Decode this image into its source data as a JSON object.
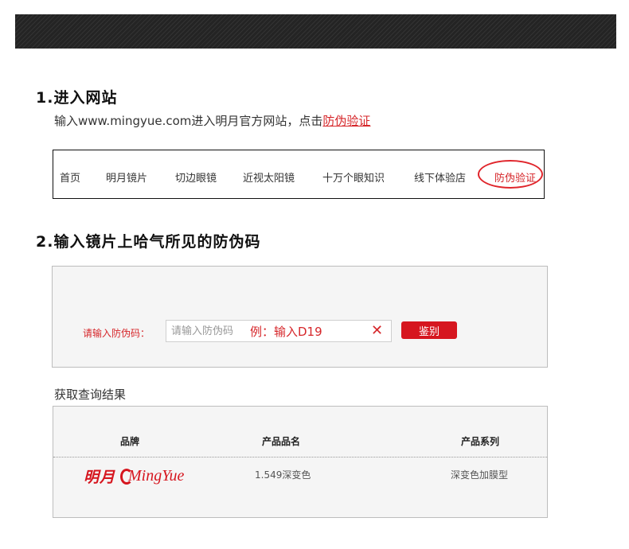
{
  "step1": {
    "title": "1.进入网站",
    "desc_prefix": "输入www.mingyue.com进入明月官方网站，点击",
    "desc_link": "防伪验证"
  },
  "nav": {
    "items": [
      "首页",
      "明月镜片",
      "切边眼镜",
      "近视太阳镜",
      "十万个眼知识",
      "线下体验店",
      "防伪验证"
    ],
    "active_index": 6
  },
  "step2": {
    "title": "2.输入镜片上哈气所见的防伪码"
  },
  "form": {
    "label": "请输入防伪码：",
    "placeholder": "请输入防伪码",
    "example": "例：输入D19",
    "clear": "✕",
    "button": "鉴别"
  },
  "result": {
    "title": "获取查询结果",
    "columns": [
      "品牌",
      "产品品名",
      "产品系列"
    ],
    "row": {
      "brand_cn": "明月",
      "brand_en": "MingYue",
      "product_name": "1.549深变色",
      "product_series": "深变色加膜型"
    }
  },
  "colors": {
    "accent": "#d6262a",
    "button": "#d6161f",
    "topbar": "#242424"
  }
}
